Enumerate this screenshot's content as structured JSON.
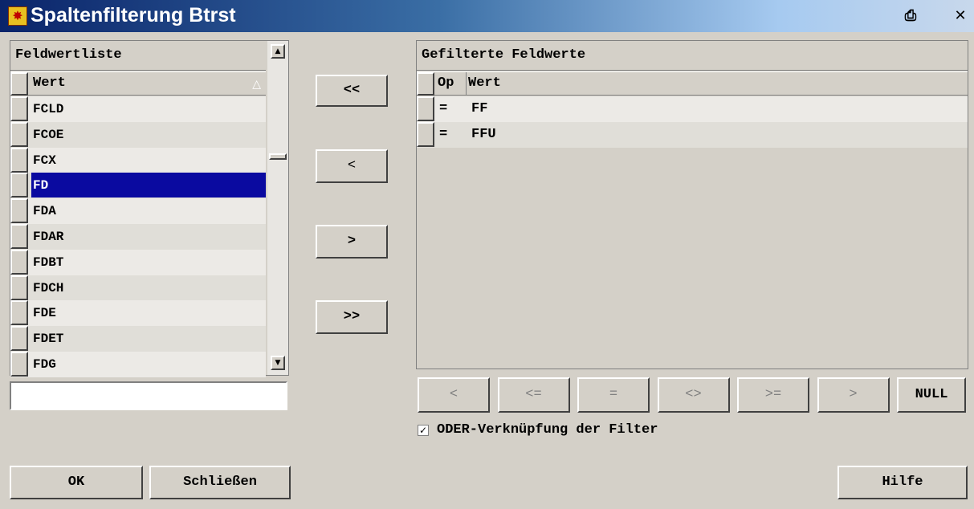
{
  "window": {
    "title": "Spaltenfilterung Btrst",
    "icons": {
      "app": "app-flag-icon",
      "print": "printer-icon",
      "close": "close-icon"
    }
  },
  "left": {
    "header": "Feldwertliste",
    "column": "Wert",
    "items": [
      "FCLD",
      "FCOE",
      "FCX",
      "FD",
      "FDA",
      "FDAR",
      "FDBT",
      "FDCH",
      "FDE",
      "FDET",
      "FDG"
    ],
    "selected": "FD",
    "search_value": ""
  },
  "transfer": {
    "remove_all": "<<",
    "remove": "<",
    "add": ">",
    "add_all": ">>"
  },
  "right": {
    "header": "Gefilterte Feldwerte",
    "col_op": "Op",
    "col_value": "Wert",
    "rows": [
      {
        "op": "=",
        "value": "FF"
      },
      {
        "op": "=",
        "value": "FFU"
      }
    ]
  },
  "operators": [
    "<",
    "<=",
    "=",
    "<>",
    ">=",
    ">",
    "NULL"
  ],
  "oder": {
    "checked": true,
    "mark": "✓",
    "label": "ODER-Verknüpfung der Filter"
  },
  "footer": {
    "ok": "OK",
    "close": "Schließen",
    "help": "Hilfe"
  },
  "colors": {
    "selection": "#0a0aa0",
    "face": "#d4d0c8",
    "title_start": "#0a246a"
  }
}
